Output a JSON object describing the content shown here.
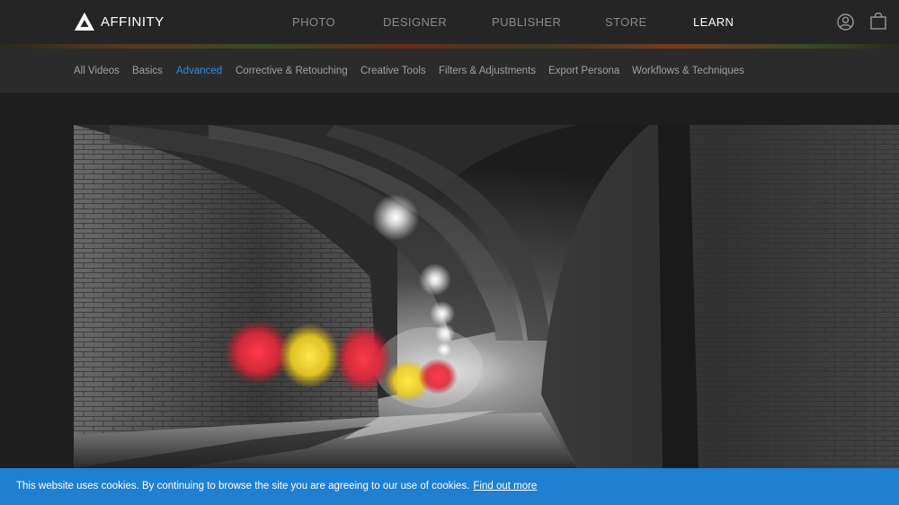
{
  "brand": {
    "name": "AFFINITY"
  },
  "main_nav": {
    "items": [
      {
        "label": "PHOTO",
        "active": false
      },
      {
        "label": "DESIGNER",
        "active": false
      },
      {
        "label": "PUBLISHER",
        "active": false
      },
      {
        "label": "STORE",
        "active": false
      },
      {
        "label": "LEARN",
        "active": true
      }
    ]
  },
  "header_icons": [
    "user-account-icon",
    "shopping-bag-icon"
  ],
  "sub_nav": {
    "items": [
      {
        "label": "All Videos",
        "active": false
      },
      {
        "label": "Basics",
        "active": false
      },
      {
        "label": "Advanced",
        "active": true
      },
      {
        "label": "Corrective & Retouching",
        "active": false
      },
      {
        "label": "Creative Tools",
        "active": false
      },
      {
        "label": "Filters & Adjustments",
        "active": false
      },
      {
        "label": "Export Persona",
        "active": false
      },
      {
        "label": "Workflows & Techniques",
        "active": false
      }
    ]
  },
  "cookie_banner": {
    "message": "This website uses cookies. By continuing to browse the site you are agreeing to our use of cookies.",
    "link_label": "Find out more"
  },
  "colors": {
    "accent": "#2a8fe0",
    "cookie_bg": "#1f7fd1",
    "header_bg": "#252525",
    "subnav_bg": "#2b2b2b",
    "page_bg": "#1e1e1e"
  }
}
